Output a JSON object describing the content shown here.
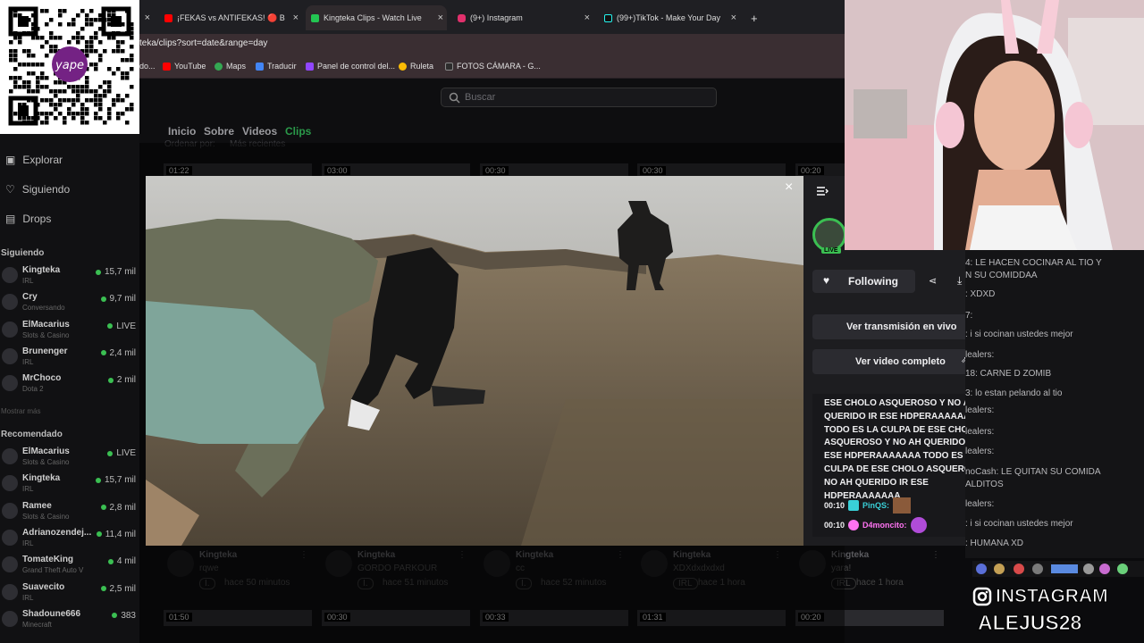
{
  "browser": {
    "tabs": [
      {
        "label": "",
        "close": "×"
      },
      {
        "label": "¡FEKAS vs ANTIFEKAS! 🔴 B",
        "close": "×"
      },
      {
        "label": "Kingteka Clips - Watch Live",
        "close": "×"
      },
      {
        "label": "(9+) Instagram",
        "close": "×"
      },
      {
        "label": "(99+)TikTok - Make Your Day",
        "close": "×"
      }
    ],
    "new_tab": "+",
    "address": "teka/clips?sort=date&range=day",
    "bookmarks": [
      "do...",
      "YouTube",
      "Maps",
      "Traducir",
      "Panel de control del...",
      "Ruleta",
      "FOTOS CÁMARA - G..."
    ]
  },
  "twitch": {
    "search_placeholder": "Buscar",
    "channel_tabs": [
      "Inicio",
      "Sobre",
      "Videos",
      "Clips"
    ],
    "sort_label": "Ordenar por:",
    "sort_value": "Más recientes",
    "sidebar": {
      "nav": [
        "Explorar",
        "Siguiendo",
        "Drops"
      ],
      "following_title": "Siguiendo",
      "following": [
        {
          "name": "Kingteka",
          "game": "IRL",
          "viewers": "15,7 mil"
        },
        {
          "name": "Cry",
          "game": "Conversando",
          "viewers": "9,7 mil"
        },
        {
          "name": "ElMacarius",
          "game": "Slots & Casino",
          "viewers": "LIVE"
        },
        {
          "name": "Brunenger",
          "game": "IRL",
          "viewers": "2,4 mil"
        },
        {
          "name": "MrChoco",
          "game": "Dota 2",
          "viewers": "2 mil"
        }
      ],
      "show_more": "Mostrar más",
      "recommended_title": "Recomendado",
      "recommended": [
        {
          "name": "ElMacarius",
          "game": "Slots & Casino",
          "viewers": "LIVE"
        },
        {
          "name": "Kingteka",
          "game": "IRL",
          "viewers": "15,7 mil"
        },
        {
          "name": "Ramee",
          "game": "Slots & Casino",
          "viewers": "2,8 mil"
        },
        {
          "name": "Adrianozendej...",
          "game": "IRL",
          "viewers": "11,4 mil"
        },
        {
          "name": "TomateKing",
          "game": "Grand Theft Auto V",
          "viewers": "4 mil"
        },
        {
          "name": "Suavecito",
          "game": "IRL",
          "viewers": "2,5 mil"
        },
        {
          "name": "Shadoune666",
          "game": "Minecraft",
          "viewers": "383"
        }
      ]
    },
    "top_thumbs": [
      "01:22",
      "03:00",
      "00:30",
      "00:30",
      "00:20"
    ],
    "bottom_thumbs": [
      "01:50",
      "00:30",
      "00:33",
      "01:31",
      "00:20"
    ],
    "cards": [
      {
        "channel": "Kingteka",
        "title": "rqwe",
        "badge": "I.",
        "ago": "hace 50 minutos"
      },
      {
        "channel": "Kingteka",
        "title": "GORDO PARKOUR",
        "badge": "I.",
        "ago": "hace 51 minutos"
      },
      {
        "channel": "Kingteka",
        "title": "cc",
        "badge": "I.",
        "ago": "hace 52 minutos"
      },
      {
        "channel": "Kingteka",
        "title": "XDXdxdxdxd",
        "badge": "IRL",
        "ago": "hace 1 hora"
      },
      {
        "channel": "Kingteka",
        "title": "yara!",
        "badge": "IRL",
        "ago": "hace 1 hora"
      }
    ]
  },
  "modal": {
    "close": "×",
    "live_badge": "LIVE",
    "follow_label": "Following",
    "watch_live": "Ver transmisión en vivo",
    "full_video": "Ver video completo",
    "clip_chat_text": "ESE CHOLO ASQUEROSO Y NO AH QUERIDO IR ESE HDPERAAAAAAA TODO ES LA CULPA DE ESE CHOLO ASQUEROSO Y NO AH QUERIDO IR ESE HDPERAAAAAAA TODO ES LA CULPA DE ESE CHOLO ASQUEROSO Y NO AH QUERIDO IR ESE HDPERAAAAAAA",
    "chat_rows": [
      {
        "time": "00:10",
        "user": "PinQS:",
        "color": "#39d0d8"
      },
      {
        "time": "00:10",
        "user": "D4moncito:",
        "color": "#ff73f2"
      }
    ]
  },
  "stream_chat": [
    "4: LE HACEN COCINAR AL TIO Y",
    "N SU COMIDDAA",
    ": XDXD",
    "7:",
    ": i si cocinan ustedes mejor",
    "lealers:",
    "18: CARNE D ZOMIB",
    "3: lo estan pelando al tio",
    "lealers:",
    "lealers:",
    "lealers:",
    "noCash: LE QUITAN SU COMIDA",
    "ALDITOS",
    "lealers:",
    ": i si cocinan ustedes mejor",
    ": HUMANA XD"
  ],
  "overlay": {
    "qr_brand": "yape",
    "instagram_label": "INSTAGRAM",
    "instagram_handle": "ALEJUS28"
  }
}
